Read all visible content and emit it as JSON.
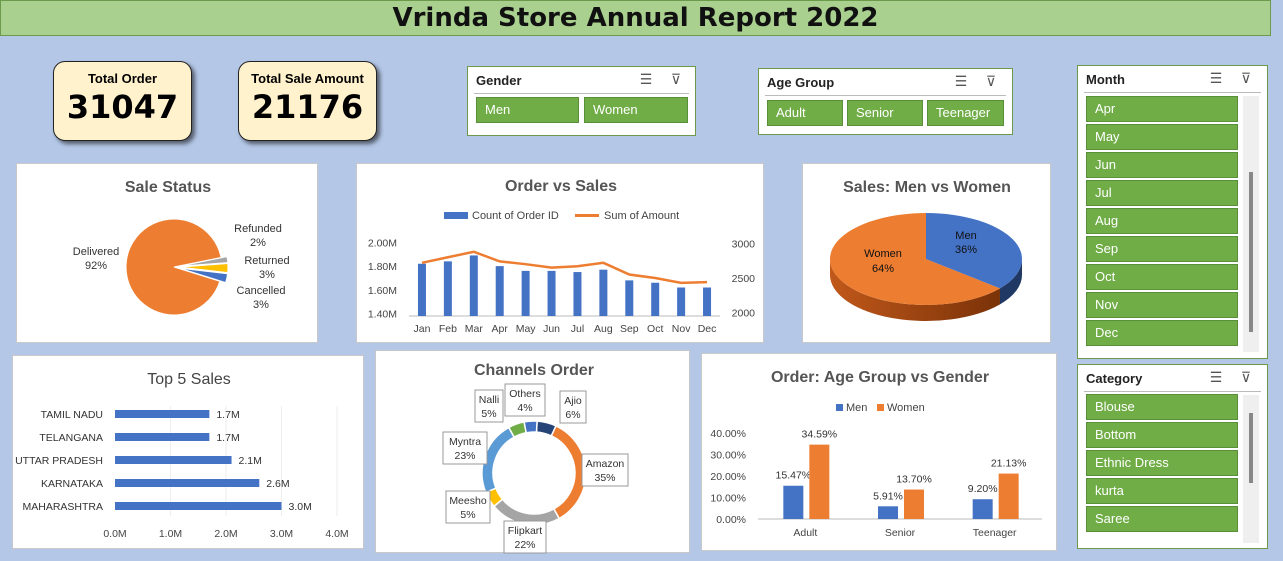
{
  "header": {
    "title": "Vrinda Store Annual Report 2022"
  },
  "kpis": {
    "total_order_label": "Total Order",
    "total_order_value": "31047",
    "total_sale_label": "Total Sale Amount",
    "total_sale_value": "21176"
  },
  "slicers": {
    "gender": {
      "title": "Gender",
      "items": [
        "Men",
        "Women"
      ]
    },
    "age_group": {
      "title": "Age Group",
      "items": [
        "Adult",
        "Senior",
        "Teenager"
      ]
    },
    "month": {
      "title": "Month",
      "items": [
        "Apr",
        "May",
        "Jun",
        "Jul",
        "Aug",
        "Sep",
        "Oct",
        "Nov",
        "Dec"
      ]
    },
    "category": {
      "title": "Category",
      "items": [
        "Blouse",
        "Bottom",
        "Ethnic Dress",
        "kurta",
        "Saree"
      ]
    }
  },
  "icons": {
    "multi_select": "multi-select-icon",
    "clear_filter": "clear-filter-icon"
  },
  "colors": {
    "blue": "#4472c4",
    "orange": "#ed7d31",
    "gray": "#a5a5a5",
    "yellow": "#ffc000",
    "green": "#70ad47",
    "slicer_green": "#70ad47",
    "page_bg": "#b4c7e7",
    "title_bg": "#a9d08e",
    "kpi_bg": "#fff2cc"
  },
  "chart_data": [
    {
      "id": "sale_status",
      "type": "pie",
      "title": "Sale Status",
      "slices": [
        {
          "name": "Delivered",
          "value": 92,
          "label": "92%",
          "color": "#ed7d31"
        },
        {
          "name": "Refunded",
          "value": 2,
          "label": "2%",
          "color": "#a5a5a5"
        },
        {
          "name": "Returned",
          "value": 3,
          "label": "3%",
          "color": "#ffc000"
        },
        {
          "name": "Cancelled",
          "value": 3,
          "label": "3%",
          "color": "#4472c4"
        }
      ]
    },
    {
      "id": "order_vs_sales",
      "type": "bar",
      "title": "Order vs Sales",
      "categories": [
        "Jan",
        "Feb",
        "Mar",
        "Apr",
        "May",
        "Jun",
        "Jul",
        "Aug",
        "Sep",
        "Oct",
        "Nov",
        "Dec"
      ],
      "series": [
        {
          "name": "Count of Order ID",
          "kind": "bar",
          "axis": "left",
          "values": [
            1.82,
            1.84,
            1.89,
            1.8,
            1.76,
            1.76,
            1.75,
            1.77,
            1.68,
            1.66,
            1.62,
            1.62
          ],
          "color": "#4472c4"
        },
        {
          "name": "Sum of Amount",
          "kind": "line",
          "axis": "right",
          "values": [
            2720,
            2800,
            2880,
            2740,
            2700,
            2650,
            2670,
            2720,
            2550,
            2500,
            2430,
            2440
          ],
          "color": "#ed7d31"
        }
      ],
      "y_left": {
        "ticks": [
          "1.40M",
          "1.60M",
          "1.80M",
          "2.00M"
        ],
        "range": [
          1.38,
          2.02
        ]
      },
      "y_right": {
        "ticks": [
          "2000",
          "2500",
          "3000"
        ],
        "range": [
          1950,
          3050
        ]
      }
    },
    {
      "id": "men_vs_women",
      "type": "pie",
      "title": "Sales: Men vs Women",
      "slices": [
        {
          "name": "Men",
          "value": 36,
          "label": "36%",
          "color": "#4472c4"
        },
        {
          "name": "Women",
          "value": 64,
          "label": "64%",
          "color": "#ed7d31"
        }
      ]
    },
    {
      "id": "top5_sales",
      "type": "bar",
      "orientation": "horizontal",
      "title": "Top 5 Sales",
      "categories": [
        "TAMIL NADU",
        "TELANGANA",
        "UTTAR PRADESH",
        "KARNATAKA",
        "MAHARASHTRA"
      ],
      "values": [
        1.7,
        1.7,
        2.1,
        2.6,
        3.0
      ],
      "labels": [
        "1.7M",
        "1.7M",
        "2.1M",
        "2.6M",
        "3.0M"
      ],
      "x_ticks": [
        "0.0M",
        "1.0M",
        "2.0M",
        "3.0M",
        "4.0M"
      ],
      "xlim": [
        0,
        4
      ],
      "color": "#4472c4"
    },
    {
      "id": "channels_order",
      "type": "pie",
      "variant": "doughnut",
      "title": "Channels Order",
      "slices": [
        {
          "name": "Ajio",
          "value": 6,
          "label": "6%",
          "color": "#264478"
        },
        {
          "name": "Amazon",
          "value": 35,
          "label": "35%",
          "color": "#ed7d31"
        },
        {
          "name": "Flipkart",
          "value": 22,
          "label": "22%",
          "color": "#a5a5a5"
        },
        {
          "name": "Meesho",
          "value": 5,
          "label": "5%",
          "color": "#ffc000"
        },
        {
          "name": "Myntra",
          "value": 23,
          "label": "23%",
          "color": "#5b9bd5"
        },
        {
          "name": "Nalli",
          "value": 5,
          "label": "5%",
          "color": "#70ad47"
        },
        {
          "name": "Others",
          "value": 4,
          "label": "4%",
          "color": "#4472c4"
        }
      ]
    },
    {
      "id": "age_vs_gender",
      "type": "bar",
      "title": "Order: Age Group  vs Gender",
      "categories": [
        "Adult",
        "Senior",
        "Teenager"
      ],
      "series": [
        {
          "name": "Men",
          "values": [
            15.47,
            5.91,
            9.2
          ],
          "labels": [
            "15.47%",
            "5.91%",
            "9.20%"
          ],
          "color": "#4472c4"
        },
        {
          "name": "Women",
          "values": [
            34.59,
            13.7,
            21.13
          ],
          "labels": [
            "34.59%",
            "13.70%",
            "21.13%"
          ],
          "color": "#ed7d31"
        }
      ],
      "y_ticks": [
        "0.00%",
        "10.00%",
        "20.00%",
        "30.00%",
        "40.00%"
      ],
      "ylim": [
        0,
        40
      ]
    }
  ]
}
